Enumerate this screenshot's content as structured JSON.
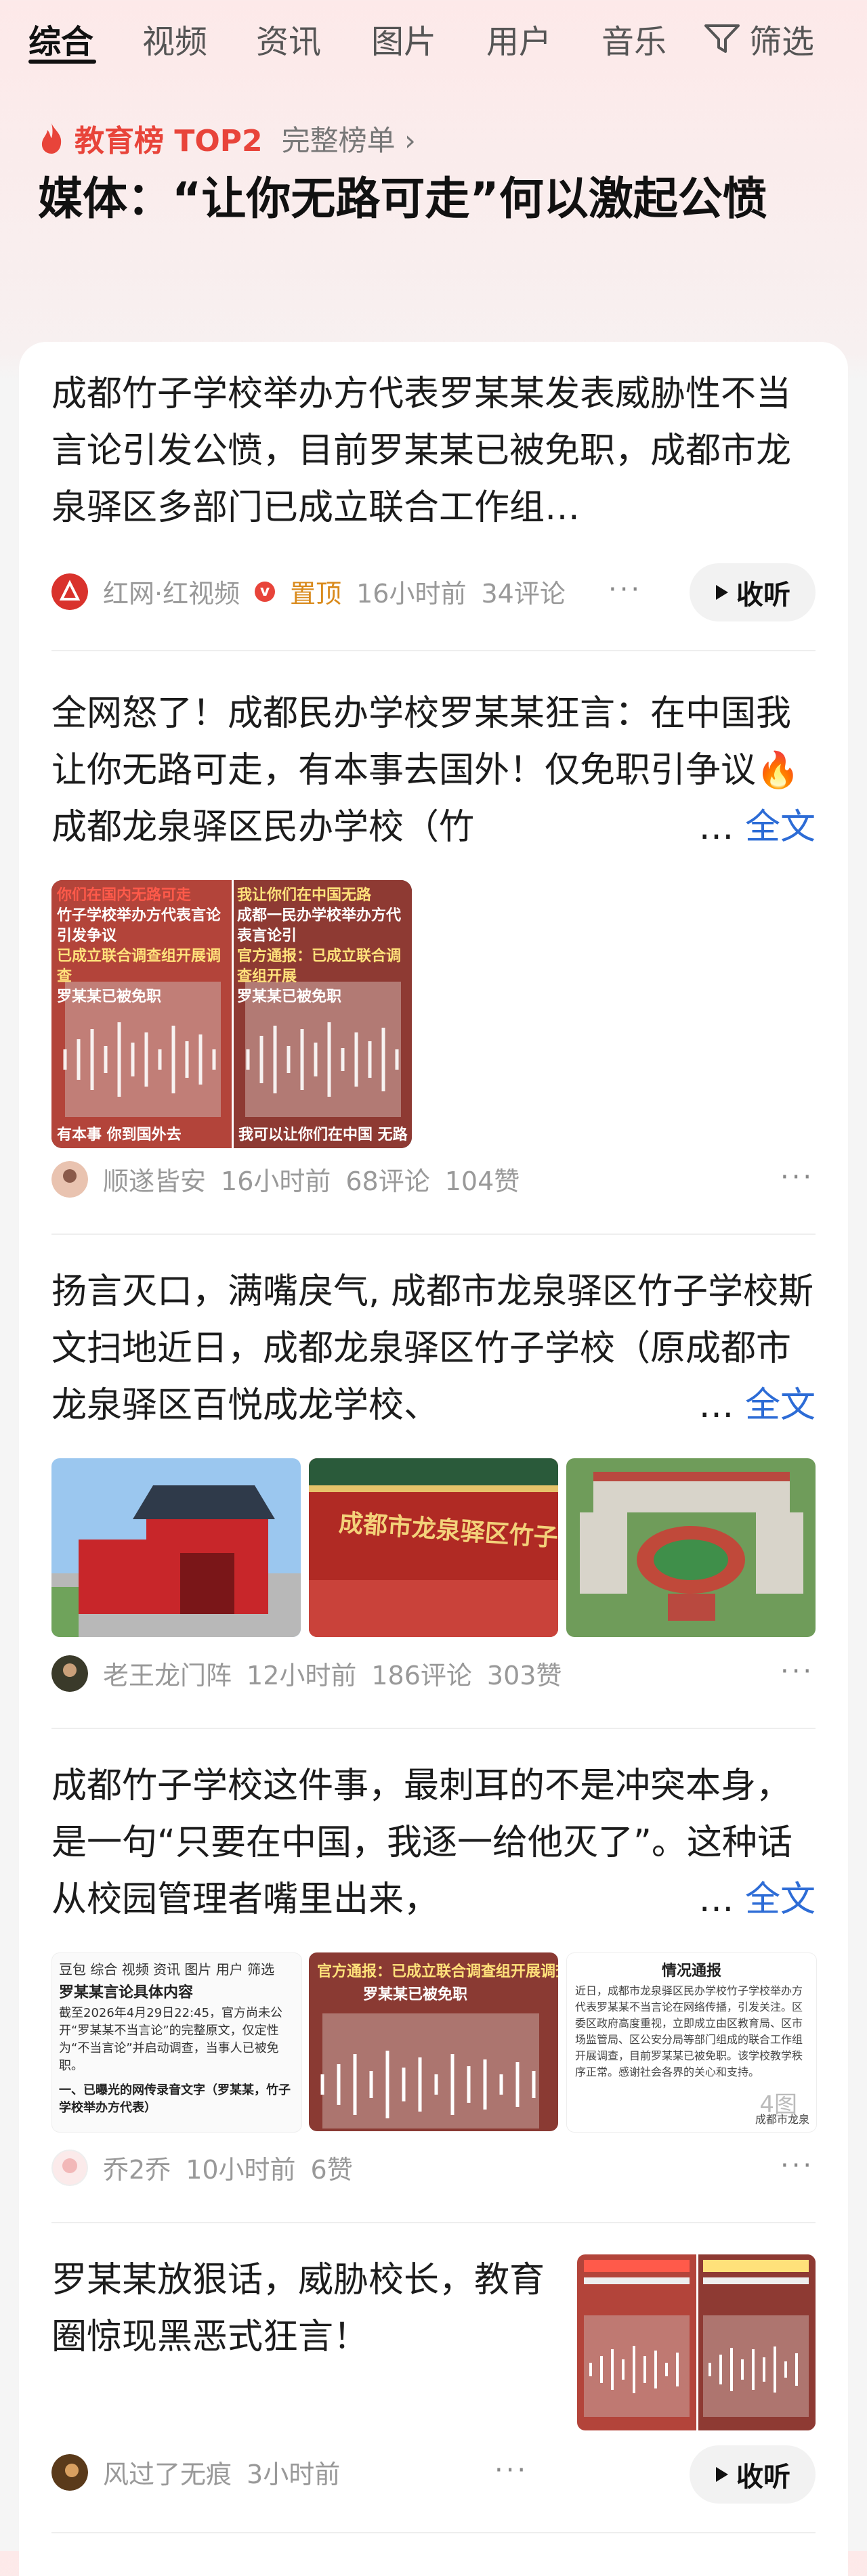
{
  "tabs": [
    "综合",
    "视频",
    "资讯",
    "图片",
    "用户",
    "音乐"
  ],
  "filter_label": "筛选",
  "hot_rank": {
    "title": "教育榜 TOP2",
    "full_label": "完整榜单 ›"
  },
  "topic_title": "媒体：“让你无路可走”何以激起公愤",
  "listen_label": "收听",
  "full_text_label": "全文",
  "ellipsis": "…",
  "posts": [
    {
      "text": "成都竹子学校举办方代表罗某某发表威胁性不当言论引发公愤，目前罗某某已被免职，成都市龙泉驿区多部门已成立联合工作组…",
      "source": "红网·红视频",
      "badge": "置顶",
      "time": "16小时前",
      "comments": "34评论"
    },
    {
      "text": "全网怒了！成都民办学校罗某某狂言：在中国我让你无路可走，有本事去国外！仅免职引争议🔥成都龙泉驿区民办学校（竹",
      "author": "顺遂皆安",
      "time": "16小时前",
      "comments": "68评论",
      "likes": "104赞",
      "thumb1_top": "你们在国内无路可走",
      "thumb1_sub": "竹子学校举办方代表言论引发争议",
      "thumb1_mid": "已成立联合调查组开展调查",
      "thumb1_red": "罗某某已被免职",
      "thumb1_bottom": "有本事 你到国外去",
      "thumb2_top": "我让你们在中国无路",
      "thumb2_sub": "成都一民办学校举办方代表言论引",
      "thumb2_mid": "官方通报：已成立联合调查组开展",
      "thumb2_red": "罗某某已被免职",
      "thumb2_bottom": "我可以让你们在中国 无路"
    },
    {
      "text": "扬言灭口，满嘴戾气, 成都市龙泉驿区竹子学校斯文扫地近日，成都龙泉驿区竹子学校（原成都市龙泉驿区百悦成龙学校、",
      "author": "老王龙门阵",
      "time": "12小时前",
      "comments": "186评论",
      "likes": "303赞",
      "sign_text": "成都市龙泉驿区竹子学校"
    },
    {
      "text": "成都竹子学校这件事，最刺耳的不是冲突本身，是一句“只要在中国，我逐一给他灭了”。这种话从校园管理者嘴里出来，",
      "author": "乔2乔",
      "time": "10小时前",
      "likes": "6赞",
      "image_count": "4图",
      "doc_tabs": "豆包  综合  视频  资讯  图片  用户  筛选",
      "doc_title": "罗某某言论具体内容",
      "doc_body": "截至2026年4月29日22:45，官方尚未公开“罗某某不当言论”的完整原文，仅定性为“不当言论”并启动调查，当事人已被免职。",
      "doc_sub": "一、已曝光的网传录音文字（罗某某，竹子学校举办方代表）",
      "notice_red": "官方通报：已成立联合调查组开展调查",
      "notice_red2": "罗某某已被免职",
      "notice_title": "情况通报",
      "notice_body": "近日，成都市龙泉驿区民办学校竹子学校举办方代表罗某某不当言论在网络传播，引发关注。区委区政府高度重视，立即成立由区教育局、区市场监管局、区公安分局等部门组成的联合工作组开展调查，目前罗某某已被免职。该学校教学秩序正常。感谢社会各界的关心和支持。",
      "notice_footer": "成都市龙泉"
    },
    {
      "text": "罗某某放狠话，威胁校长，教育圈惊现黑恶式狂言！",
      "author": "风过了无痕",
      "time": "3小时前"
    }
  ]
}
